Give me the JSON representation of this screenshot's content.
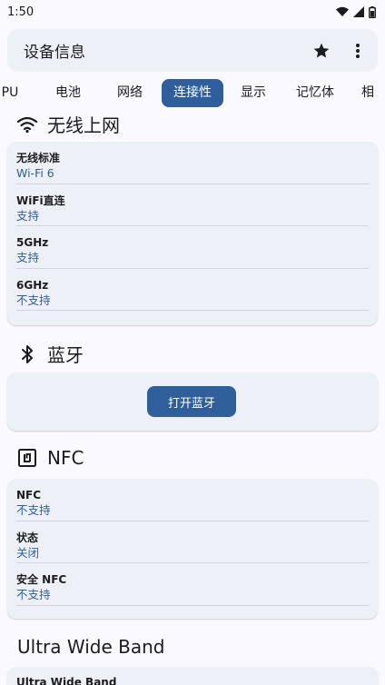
{
  "status_bar": {
    "time": "1:50"
  },
  "topbar": {
    "title": "设备信息"
  },
  "tabs": [
    {
      "label": "PU"
    },
    {
      "label": "电池"
    },
    {
      "label": "网络"
    },
    {
      "label": "连接性"
    },
    {
      "label": "显示"
    },
    {
      "label": "记忆体"
    },
    {
      "label": "相"
    }
  ],
  "active_tab": "连接性",
  "wifi": {
    "title": "无线上网",
    "rows": [
      {
        "label": "无线标准",
        "value": "Wi-Fi 6"
      },
      {
        "label": "WiFi直连",
        "value": "支持"
      },
      {
        "label": "5GHz",
        "value": "支持"
      },
      {
        "label": "6GHz",
        "value": "不支持"
      }
    ]
  },
  "bluetooth": {
    "title": "蓝牙",
    "button_label": "打开蓝牙"
  },
  "nfc": {
    "title": "NFC",
    "rows": [
      {
        "label": "NFC",
        "value": "不支持"
      },
      {
        "label": "状态",
        "value": "关闭"
      },
      {
        "label": "安全 NFC",
        "value": "不支持"
      }
    ]
  },
  "uwb": {
    "title": "Ultra Wide Band",
    "rows": [
      {
        "label": "Ultra Wide Band"
      }
    ]
  },
  "colors": {
    "accent": "#2e5f9a",
    "card": "#eef0f8",
    "background": "#f9f9ff"
  },
  "icons": [
    "wifi-status-icon",
    "signal-icon",
    "battery-icon",
    "star-icon",
    "more-vert-icon",
    "wifi-icon",
    "bluetooth-icon",
    "nfc-icon"
  ]
}
